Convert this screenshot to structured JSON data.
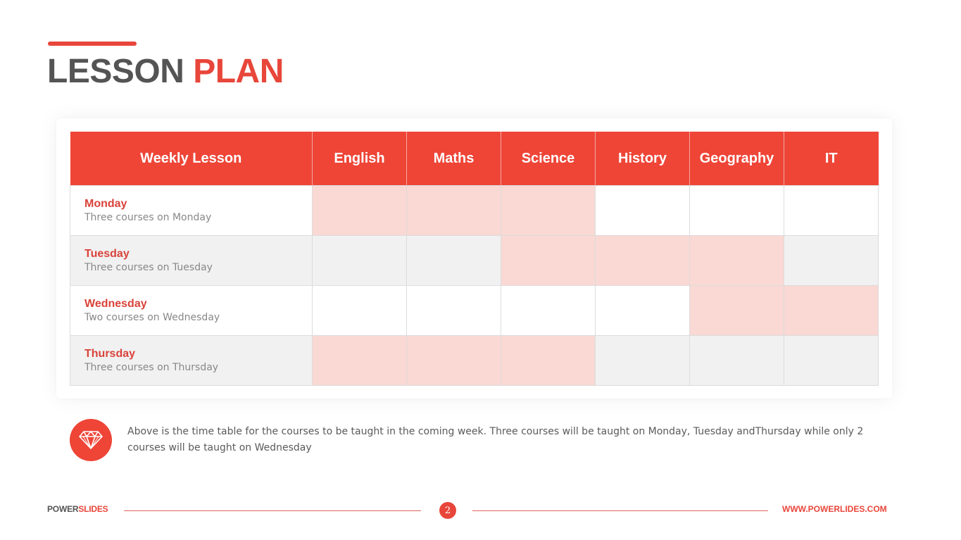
{
  "title": {
    "part1": "LESSON",
    "part2": "PLAN"
  },
  "colors": {
    "accent": "#ee4537",
    "highlight": "#fad8d3",
    "alt_row": "#f1f1f1"
  },
  "table": {
    "headers": [
      "Weekly Lesson",
      "English",
      "Maths",
      "Science",
      "History",
      "Geography",
      "IT"
    ],
    "rows": [
      {
        "day": "Monday",
        "note": "Three courses on Monday",
        "scheduled": [
          true,
          true,
          true,
          false,
          false,
          false
        ]
      },
      {
        "day": "Tuesday",
        "note": "Three courses on Tuesday",
        "scheduled": [
          false,
          false,
          true,
          true,
          true,
          false
        ]
      },
      {
        "day": "Wednesday",
        "note": "Two courses on Wednesday",
        "scheduled": [
          false,
          false,
          false,
          false,
          true,
          true
        ]
      },
      {
        "day": "Thursday",
        "note": "Three courses on Thursday",
        "scheduled": [
          true,
          true,
          true,
          false,
          false,
          false
        ]
      }
    ]
  },
  "description": {
    "icon": "diamond-icon",
    "text": "Above is the time table for the courses to be taught in the coming week. Three courses will be taught on Monday, Tuesday andThursday while only 2 courses will be taught on Wednesday"
  },
  "footer": {
    "brand_part1": "POWER",
    "brand_part2": "SLIDES",
    "page_number": "2",
    "url": "WWW.POWERLIDES.COM"
  }
}
